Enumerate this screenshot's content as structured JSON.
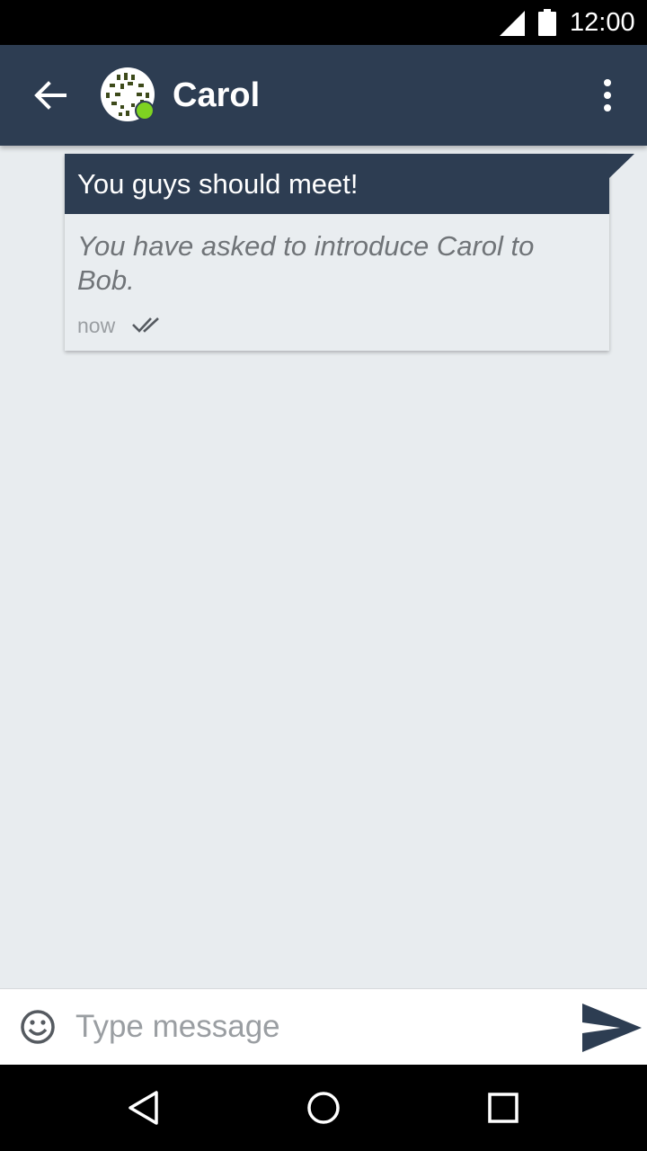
{
  "status_bar": {
    "time": "12:00",
    "icons": [
      "signal-icon",
      "battery-icon"
    ]
  },
  "app_bar": {
    "title": "Carol",
    "online": true,
    "colors": {
      "background": "#2d3d52",
      "online_dot": "#7ed321"
    },
    "icons": [
      "back-arrow-icon",
      "contact-avatar",
      "overflow-menu-icon"
    ]
  },
  "conversation": {
    "messages": [
      {
        "header": "You guys should meet!",
        "body": "You have asked to introduce Carol to Bob.",
        "time": "now",
        "status_icon": "double-check-icon"
      }
    ]
  },
  "composer": {
    "placeholder": "Type message",
    "value": "",
    "icons": [
      "emoji-icon",
      "send-icon"
    ]
  },
  "nav_bar": {
    "icons": [
      "back-nav-icon",
      "home-nav-icon",
      "recents-nav-icon"
    ]
  }
}
